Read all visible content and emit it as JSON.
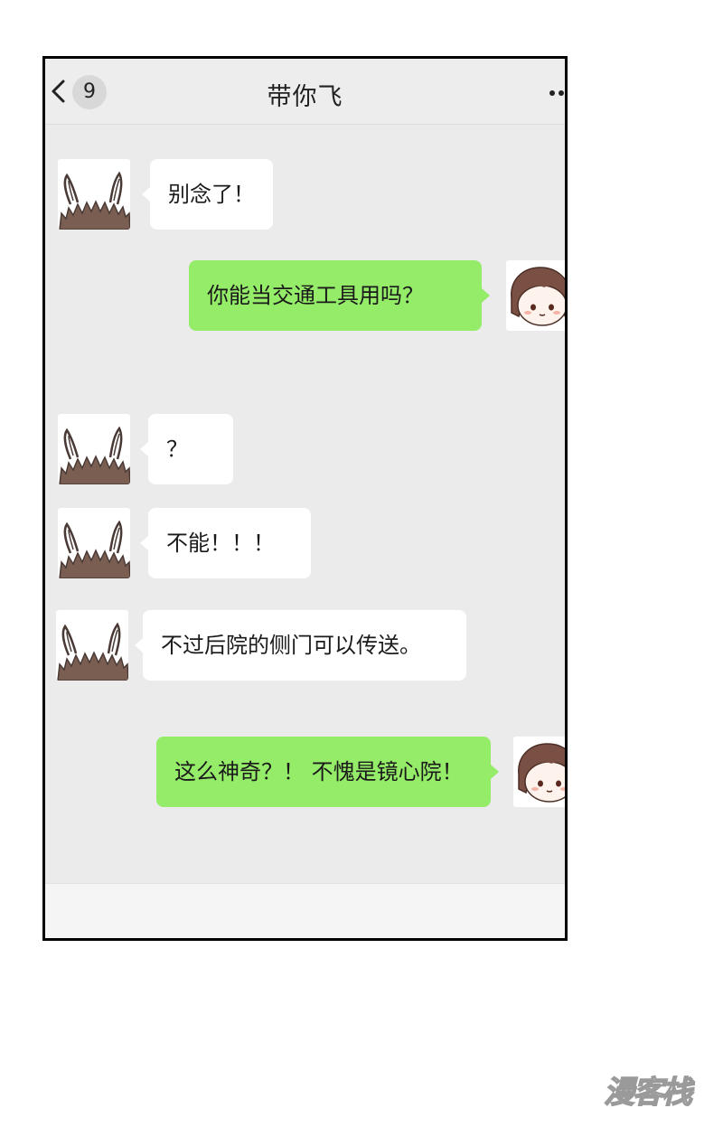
{
  "header": {
    "back_icon": "chevron-left-icon",
    "unread_count": "9",
    "title": "带你飞",
    "more_icon": "ellipsis-icon"
  },
  "messages": [
    {
      "side": "incoming",
      "sender": "rabbit-ears-avatar",
      "text": "别念了！"
    },
    {
      "side": "outgoing",
      "sender": "girl-avatar",
      "text": "你能当交通工具用吗？"
    },
    {
      "side": "incoming",
      "sender": "rabbit-ears-avatar",
      "text": "？"
    },
    {
      "side": "incoming",
      "sender": "rabbit-ears-avatar",
      "text": "不能！！！"
    },
    {
      "side": "incoming",
      "sender": "rabbit-ears-avatar",
      "text": "不过后院的侧门可以传送。"
    },
    {
      "side": "outgoing",
      "sender": "girl-avatar",
      "text": "这么神奇？！ 不愧是镜心院！"
    }
  ],
  "watermark": {
    "text": "漫客栈"
  },
  "colors": {
    "chat_background": "#ebebeb",
    "incoming_bubble": "#ffffff",
    "outgoing_bubble": "#95ec69",
    "frame_border": "#000000"
  }
}
